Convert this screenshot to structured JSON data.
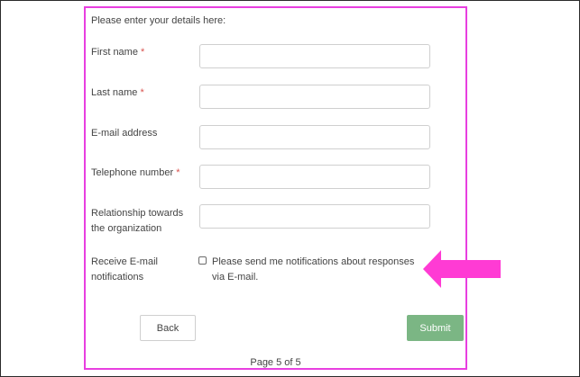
{
  "form": {
    "intro": "Please enter your details here:",
    "required_mark": "*",
    "fields": [
      {
        "label": "First name",
        "required": true,
        "value": "",
        "placeholder": ""
      },
      {
        "label": "Last name",
        "required": true,
        "value": "",
        "placeholder": ""
      },
      {
        "label": "E-mail address",
        "required": false,
        "value": "",
        "placeholder": ""
      },
      {
        "label": "Telephone number",
        "required": true,
        "value": "",
        "placeholder": ""
      },
      {
        "label": "Relationship towards the organization",
        "required": false,
        "value": "",
        "placeholder": ""
      }
    ],
    "notifications": {
      "label": "Receive E-mail notifications",
      "checkbox_label": "Please send me notifications about responses via E-mail.",
      "checked": false
    },
    "buttons": {
      "back": "Back",
      "submit": "Submit"
    },
    "page_indicator": "Page 5 of 5"
  },
  "annotation": {
    "highlight_color": "#e83fe0",
    "arrow_icon": "left-arrow-icon"
  },
  "colors": {
    "required": "#d9534f",
    "submit": "#7bb684"
  }
}
